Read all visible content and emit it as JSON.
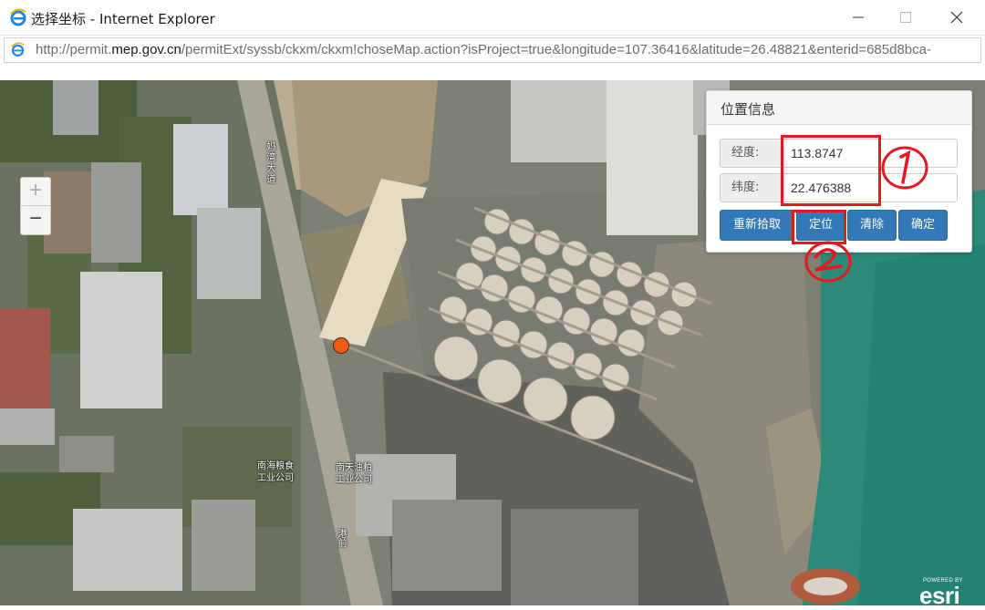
{
  "window": {
    "title": "选择坐标 - Internet Explorer",
    "icon": "internet-explorer-icon"
  },
  "address_bar": {
    "url_prefix": "http://permit.",
    "url_host": "mep.gov.cn",
    "url_rest": "/permitExt/syssb/ckxm/ckxm!choseMap.action?isProject=true&longitude=107.36416&latitude=26.48821&enterid=685d8bca-"
  },
  "map": {
    "zoom_in_label": "+",
    "zoom_out_label": "−",
    "labels": {
      "road": "妈湾大道",
      "company1_line1": "南海粮食",
      "company1_line2": "工业公司",
      "company2_line1": "南天油粕",
      "company2_line2": "工业公司",
      "road2": "港前"
    },
    "attribution": {
      "powered": "POWERED BY",
      "brand": "esri"
    }
  },
  "panel": {
    "title": "位置信息",
    "longitude_label": "经度:",
    "longitude_value": "113.8747",
    "latitude_label": "纬度:",
    "latitude_value": "22.476388",
    "buttons": {
      "repick": "重新拾取",
      "locate": "定位",
      "clear": "清除",
      "confirm": "确定"
    }
  },
  "colors": {
    "accent": "#3379b7",
    "annotation": "#e5171f",
    "marker": "#f05a14"
  }
}
